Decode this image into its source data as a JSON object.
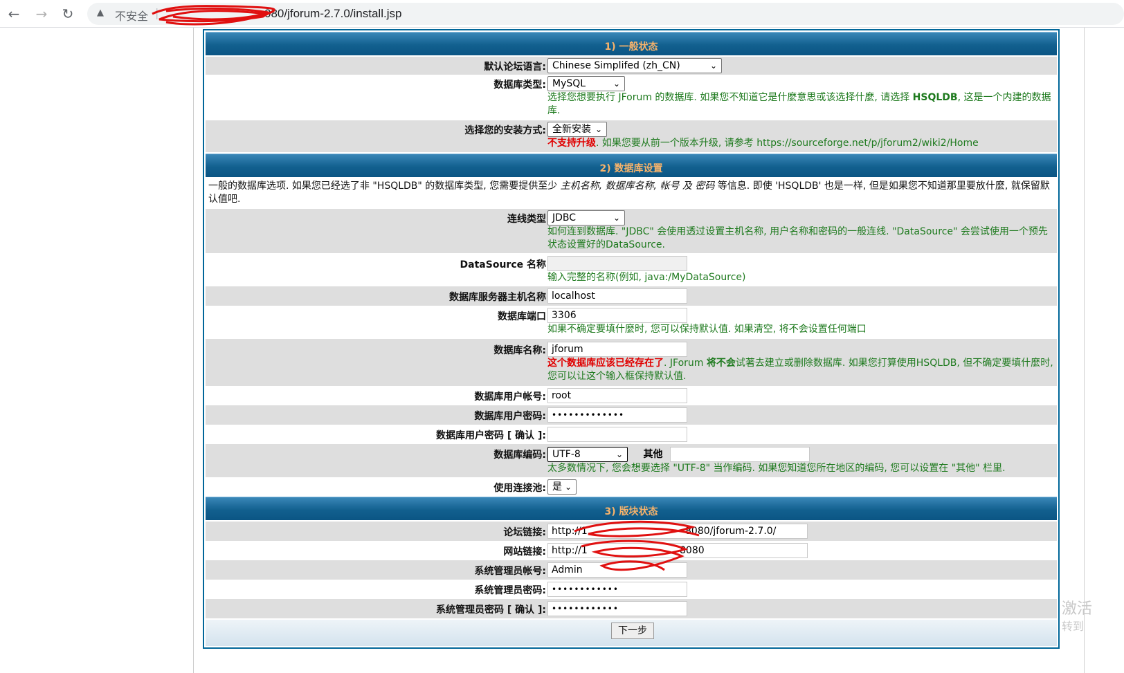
{
  "browser": {
    "back_icon": "back-arrow-icon",
    "forward_icon": "forward-arrow-icon",
    "reload_icon": "reload-icon",
    "warning_icon": "warning-icon",
    "insecure_label": "不安全",
    "url": "080/jforum-2.7.0/install.jsp"
  },
  "sections": {
    "general_title": "1) 一般状态",
    "database_title": "2) 数据库设置",
    "board_title": "3) 版块状态"
  },
  "general": {
    "language_label": "默认论坛语言:",
    "language_value": "Chinese Simplifed (zh_CN)",
    "dbtype_label": "数据库类型:",
    "dbtype_value": "MySQL",
    "dbtype_help_1": "选择您想要执行 JForum 的数据库. 如果您不知道它是什麼意思或该选择什麼, 请选择 ",
    "dbtype_help_bold": "HSQLDB",
    "dbtype_help_2": ", 这是一个内建的数据库.",
    "install_label": "选择您的安装方式:",
    "install_value": "全新安装",
    "install_help_red": "不支持升级",
    "install_help": ". 如果您要从前一个版本升级, 请参考 https://sourceforge.net/p/jforum2/wiki2/Home"
  },
  "database": {
    "intro_1": "一般的数据库选项. 如果您已经选了非 \"HSQLDB\" 的数据库类型, 您需要提供至少 ",
    "intro_em": "主机名称, 数据库名称, 帐号 及 密码",
    "intro_2": " 等信息. 即使 'HSQLDB' 也是一样, 但是如果您不知道那里要放什麼, 就保留默认值吧.",
    "conn_label": "连线类型",
    "conn_value": "JDBC",
    "conn_help": "如何连到数据库. \"JDBC\" 会使用透过设置主机名称, 用户名称和密码的一般连线. \"DataSource\" 会尝试使用一个预先状态设置好的DataSource.",
    "ds_label": "DataSource 名称",
    "ds_value": "",
    "ds_help": "输入完整的名称(例如, java:/MyDataSource)",
    "host_label": "数据库服务器主机名称",
    "host_value": "localhost",
    "port_label": "数据库端口",
    "port_value": "3306",
    "port_help": "如果不确定要填什麼时, 您可以保持默认值. 如果清空, 将不会设置任何端口",
    "name_label": "数据库名称:",
    "name_value": "jforum",
    "name_help_red": "这个数据库应该已经存在了",
    "name_help_1": ". JForum ",
    "name_help_bold": "将不会",
    "name_help_2": "试著去建立或删除数据库. 如果您打算使用HSQLDB, 但不确定要填什麼时, 您可以让这个输入框保持默认值.",
    "user_label": "数据库用户帐号:",
    "user_value": "root",
    "pass_label": "数据库用户密码:",
    "pass_value": "•••••••••••••",
    "pass_confirm_label": "数据库用户密码 [ 确认 ]:",
    "pass_confirm_value": "",
    "enc_label": "数据库编码:",
    "enc_value": "UTF-8",
    "enc_other_label": "其他",
    "enc_other_value": "",
    "enc_help": "太多数情况下, 您会想要选择 \"UTF-8\" 当作编码. 如果您知道您所在地区的编码, 您可以设置在 \"其他\" 栏里.",
    "pool_label": "使用连接池:",
    "pool_value": "是"
  },
  "board": {
    "forum_link_label": "论坛链接:",
    "forum_link_value": "http://1",
    "forum_link_tail": "8080/jforum-2.7.0/",
    "site_link_label": "网站链接:",
    "site_link_value": "http://1",
    "site_link_tail": "8080",
    "admin_user_label": "系统管理员帐号:",
    "admin_user_value": "Admin",
    "admin_pass_label": "系统管理员密码:",
    "admin_pass_value": "••••••••••••",
    "admin_pass_confirm_label": "系统管理员密码 [ 确认 ]:",
    "admin_pass_confirm_value": "••••••••••••"
  },
  "next_button": "下一步",
  "watermark": {
    "line1": "激活",
    "line2": "转到"
  }
}
